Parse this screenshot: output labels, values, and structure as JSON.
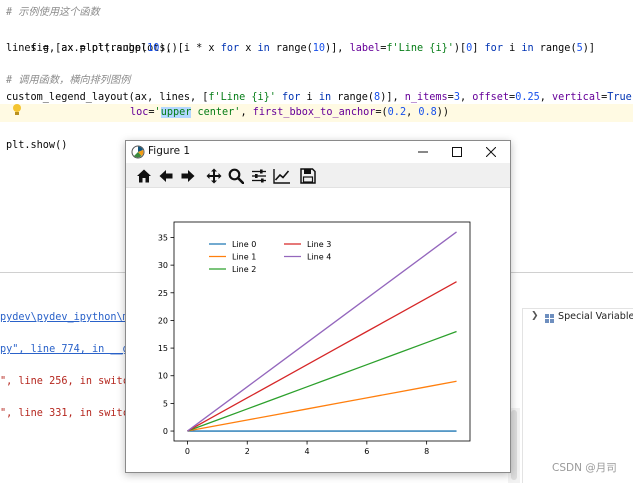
{
  "editor": {
    "comment1": "# 示例使用这个函数",
    "line2": {
      "p1": "fig, ax = plt.subplots()"
    },
    "line3": {
      "p1": "lines = [ax.plot(range(",
      "n10a": "10",
      "p2": "), [i * x ",
      "kw_for1": "for",
      "p3": " x ",
      "kw_in1": "in",
      "p4": " range(",
      "n10b": "10",
      "p5": ")], ",
      "kw_label": "label",
      "p6": "=",
      "s_label": "f'Line {i}'",
      "p7": ")[",
      "n0": "0",
      "p8": "] ",
      "kw_for2": "for",
      "p9": " i ",
      "kw_in2": "in",
      "p10": " range(",
      "n5": "5",
      "p11": ")]"
    },
    "comment2": "# 调用函数，横向排列图例",
    "line6": {
      "p1": "custom_legend_layout(ax, lines, [",
      "s_fline": "f'Line {i}'",
      "p2": " ",
      "kw_for": "for",
      "p3": " i ",
      "kw_in": "in",
      "p4": " range(",
      "n8": "8",
      "p5": ")], ",
      "kw_nitems": "n_items",
      "p6": "=",
      "n3": "3",
      "p7": ", ",
      "kw_offset": "offset",
      "p8": "=",
      "n025": "0.25",
      "p9": ", ",
      "kw_vertical": "vertical",
      "p10": "=",
      "kw_true": "True",
      "p11": ","
    },
    "line7": {
      "kw_loc": "loc",
      "p1": "=",
      "s_q1": "'",
      "s_sel": "upper",
      "s_q2": " center'",
      "p2": ", ",
      "kw_bbox": "first_bbox_to_anchor",
      "p3": "=(",
      "n02": "0.2",
      "p4": ", ",
      "n08": "0.8",
      "p5": "))"
    },
    "line9": "plt.show()"
  },
  "console": {
    "line1": "pydev\\pydev_ipython\\m",
    "line2_a": "py\", line 774, in __g",
    "line3": "\", line 256, in switc",
    "line4": "\", line 331, in switc"
  },
  "vars_panel": {
    "label": "Special Variables"
  },
  "watermark": "CSDN @月司",
  "figure": {
    "window_title": "Figure 1",
    "toolbar": {
      "icons": [
        "home-icon",
        "back-icon",
        "forward-icon",
        "pan-icon",
        "zoom-icon",
        "configure-subplots-icon",
        "edit-axis-icon",
        "save-icon"
      ]
    }
  },
  "chart_data": {
    "type": "line",
    "x": [
      0,
      1,
      2,
      3,
      4,
      5,
      6,
      7,
      8,
      9
    ],
    "series": [
      {
        "name": "Line 0",
        "values": [
          0,
          0,
          0,
          0,
          0,
          0,
          0,
          0,
          0,
          0
        ],
        "color": "#1f77b4"
      },
      {
        "name": "Line 1",
        "values": [
          0,
          1,
          2,
          3,
          4,
          5,
          6,
          7,
          8,
          9
        ],
        "color": "#ff7f0e"
      },
      {
        "name": "Line 2",
        "values": [
          0,
          2,
          4,
          6,
          8,
          10,
          12,
          14,
          16,
          18
        ],
        "color": "#2ca02c"
      },
      {
        "name": "Line 3",
        "values": [
          0,
          3,
          6,
          9,
          12,
          15,
          18,
          21,
          24,
          27
        ],
        "color": "#d62728"
      },
      {
        "name": "Line 4",
        "values": [
          0,
          4,
          8,
          12,
          16,
          20,
          24,
          28,
          32,
          36
        ],
        "color": "#9467bd"
      }
    ],
    "xlim": [
      -0.45,
      9.45
    ],
    "ylim": [
      -1.8,
      37.8
    ],
    "xticks": [
      "0",
      "2",
      "4",
      "6",
      "8"
    ],
    "yticks": [
      "0",
      "5",
      "10",
      "15",
      "20",
      "25",
      "30",
      "35"
    ],
    "legend": {
      "placement": "upper-left",
      "columns": [
        [
          "Line 0",
          "Line 1",
          "Line 2"
        ],
        [
          "Line 3",
          "Line 4"
        ]
      ]
    },
    "grid": false
  }
}
